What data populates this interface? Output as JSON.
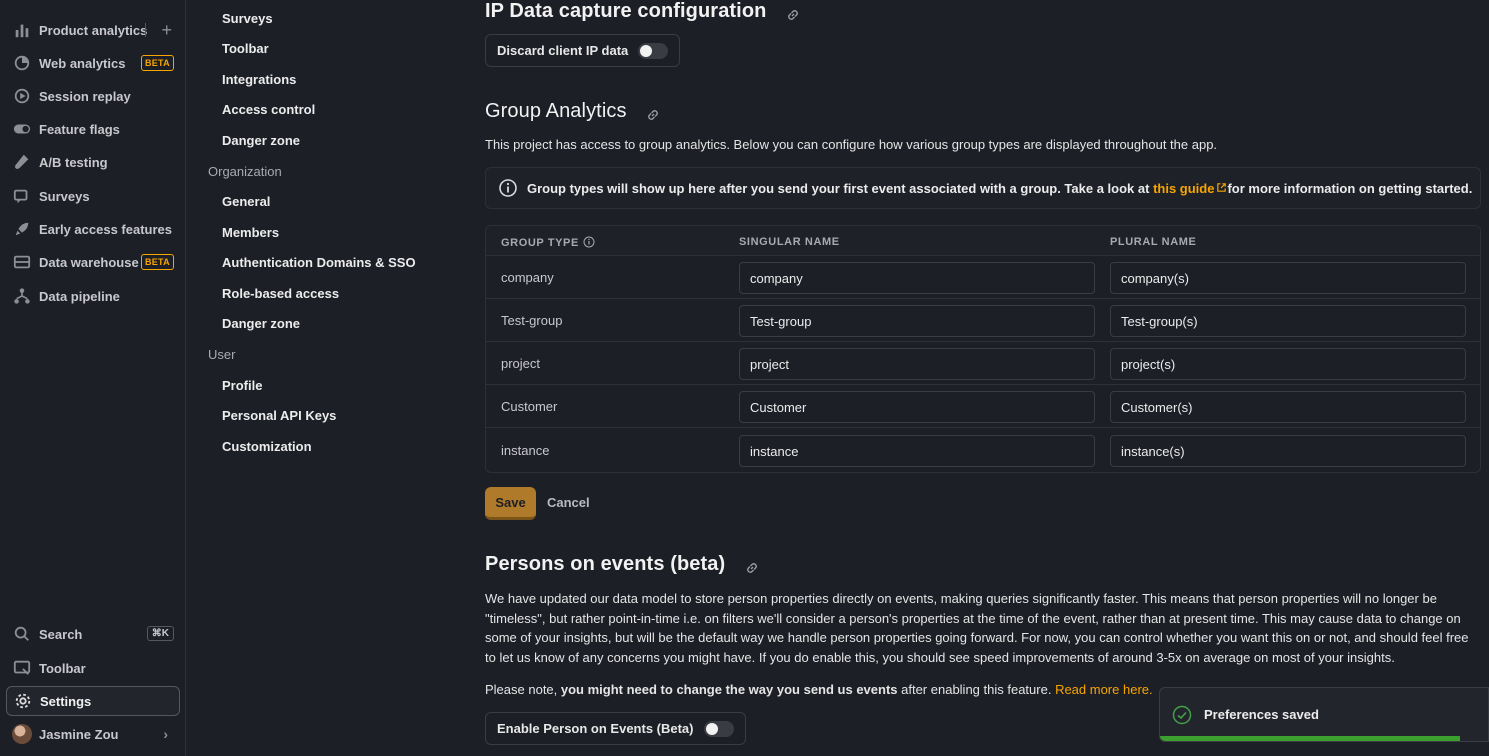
{
  "leftnav": {
    "items": [
      {
        "label": "Product analytics",
        "icon": "bar-chart-icon"
      },
      {
        "label": "Web analytics",
        "icon": "pie-chart-icon",
        "badge": "BETA"
      },
      {
        "label": "Session replay",
        "icon": "replay-icon"
      },
      {
        "label": "Feature flags",
        "icon": "toggle-icon"
      },
      {
        "label": "A/B testing",
        "icon": "flask-icon"
      },
      {
        "label": "Surveys",
        "icon": "chat-icon"
      },
      {
        "label": "Early access features",
        "icon": "rocket-icon"
      },
      {
        "label": "Data warehouse",
        "icon": "database-icon",
        "badge": "BETA"
      },
      {
        "label": "Data pipeline",
        "icon": "pipeline-icon"
      }
    ],
    "bottom": {
      "search": "Search",
      "search_shortcut": "⌘K",
      "toolbar": "Toolbar",
      "settings": "Settings",
      "user": "Jasmine Zou"
    }
  },
  "subnav": {
    "project_links": [
      "Surveys",
      "Toolbar",
      "Integrations",
      "Access control",
      "Danger zone"
    ],
    "org_heading": "Organization",
    "org_links": [
      "General",
      "Members",
      "Authentication Domains & SSO",
      "Role-based access",
      "Danger zone"
    ],
    "user_heading": "User",
    "user_links": [
      "Profile",
      "Personal API Keys",
      "Customization"
    ]
  },
  "ip": {
    "title": "IP Data capture configuration",
    "toggle_label": "Discard client IP data",
    "toggle_on": false
  },
  "group": {
    "title": "Group Analytics",
    "description": "This project has access to group analytics. Below you can configure how various group types are displayed throughout the app.",
    "info_prefix": "Group types will show up here after you send your first event associated with a group. Take a look at ",
    "info_link": "this guide",
    "info_suffix": "for more information on getting started.",
    "columns": [
      "GROUP TYPE",
      "SINGULAR NAME",
      "PLURAL NAME"
    ],
    "rows": [
      {
        "type": "company",
        "singular": "company",
        "plural": "company(s)"
      },
      {
        "type": "Test-group",
        "singular": "Test-group",
        "plural": "Test-group(s)"
      },
      {
        "type": "project",
        "singular": "project",
        "plural": "project(s)"
      },
      {
        "type": "Customer",
        "singular": "Customer",
        "plural": "Customer(s)"
      },
      {
        "type": "instance",
        "singular": "instance",
        "plural": "instance(s)"
      }
    ],
    "save_label": "Save",
    "cancel_label": "Cancel"
  },
  "poe": {
    "title": "Persons on events (beta)",
    "lines": [
      "We have updated our data model to store person properties directly on events, making queries significantly faster. This means that person properties will no longer be",
      "\"timeless\", but rather point-in-time i.e. on filters we'll consider a person's properties at the time of the event, rather than at present time. This may cause data to change on",
      "some of your insights, but will be the default way we handle person properties going forward. For now, you can control whether you want this on or not, and should feel free",
      "to let us know of any concerns you might have. If you do enable this, you should see speed improvements of around 3-5x on average on most of your insights."
    ],
    "note_prefix": "Please note, ",
    "note_bold": "you might need to change the way you send us events",
    "note_suffix": " after enabling this feature. ",
    "note_link": "Read more here.",
    "toggle_label": "Enable Person on Events (Beta)",
    "toggle_on": false
  },
  "toast": {
    "message": "Preferences saved"
  },
  "colors": {
    "accent": "#f7a501",
    "save_button": "#b07a2b",
    "success": "#3ba02d"
  }
}
